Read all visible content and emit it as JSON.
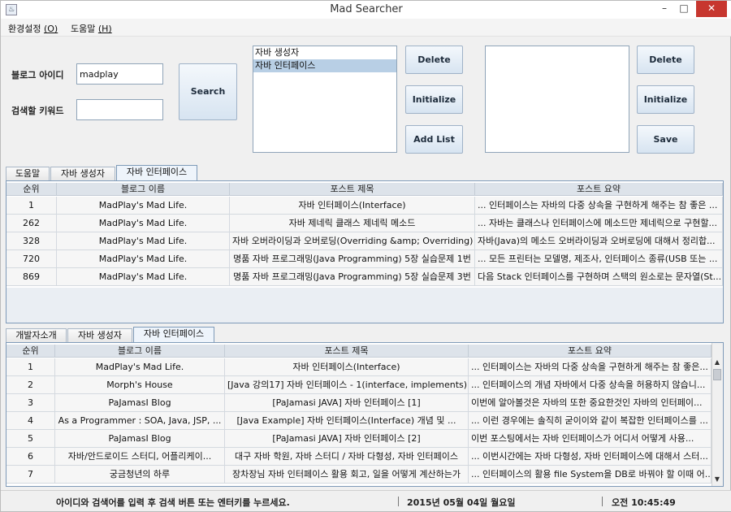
{
  "window": {
    "app_icon": "java-icon",
    "title": "Mad Searcher",
    "minimize": "–",
    "maximize": "□",
    "close": "✕"
  },
  "menu": [
    {
      "label": "환경설정 ",
      "mnemonic": "(O)"
    },
    {
      "label": "도움말 ",
      "mnemonic": "(H)"
    }
  ],
  "form": {
    "blog_id_label": "블로그 아이디",
    "blog_id_value": "madplay",
    "keyword_label": "검색할 키워드",
    "keyword_value": "",
    "search_button": "Search"
  },
  "left_list": {
    "items": [
      "자바 생성자",
      "자바 인터페이스"
    ],
    "selected_index": 1
  },
  "left_buttons": {
    "delete": "Delete",
    "initialize": "Initialize",
    "add_list": "Add List"
  },
  "right_list": {
    "items": []
  },
  "right_buttons": {
    "delete": "Delete",
    "initialize": "Initialize",
    "save": "Save"
  },
  "top_tabs": {
    "items": [
      "도움말",
      "자바 생성자",
      "자바 인터페이스"
    ],
    "active_index": 2
  },
  "top_table": {
    "columns": [
      "순위",
      "블로그 이름",
      "포스트 제목",
      "포스트 요약"
    ],
    "rows": [
      [
        "1",
        "MadPlay's Mad Life.",
        "자바 인터페이스(Interface)",
        "... 인터페이스는 자바의 다중 상속을 구현하게 해주는 참 좋은 ..."
      ],
      [
        "262",
        "MadPlay's Mad Life.",
        "자바 제네릭 클래스 제네릭 메소드",
        "... 자바는 클래스나 인터페이스에 메소드만 제네릭으로 구현할..."
      ],
      [
        "328",
        "MadPlay's Mad Life.",
        "자바 오버라이딩과 오버로딩(Overriding &amp; Overriding)",
        "자바(Java)의 메소드 오버라이딩과 오버로딩에 대해서 정리합..."
      ],
      [
        "720",
        "MadPlay's Mad Life.",
        "명품 자바 프로그래밍(Java Programming) 5장 실습문제 1번",
        "... 모든 프린터는 모델명, 제조사, 인터페이스 종류(USB 또는 ..."
      ],
      [
        "869",
        "MadPlay's Mad Life.",
        "명품 자바 프로그래밍(Java Programming) 5장 실습문제 3번",
        "다음 Stack 인터페이스를 구현하며 스택의 원소로는 문자열(St..."
      ]
    ]
  },
  "bottom_tabs": {
    "items": [
      "개발자소개",
      "자바 생성자",
      "자바 인터페이스"
    ],
    "active_index": 2
  },
  "bottom_table": {
    "columns": [
      "순위",
      "블로그 이름",
      "포스트 제목",
      "포스트 요약"
    ],
    "rows": [
      [
        "1",
        "MadPlay's Mad Life.",
        "자바 인터페이스(Interface)",
        "... 인터페이스는 자바의 다중 상속을 구현하게 해주는 참 좋은..."
      ],
      [
        "2",
        "Morph's House",
        "[Java 강의17] 자바 인터페이스 - 1(interface, implements)",
        "... 인터페이스의 개념 자바에서 다중 상속을 허용하지 않습니..."
      ],
      [
        "3",
        "PaJamasI Blog",
        "[PaJamasi JAVA] 자바 인터페이스 [1]",
        "이번에 알아볼것은 자바의 또한 중요한것인 자바의 인터페이..."
      ],
      [
        "4",
        "As a Programmer : SOA, Java, JSP, ...",
        "[Java Example] 자바 인터페이스(Interface) 개념 및 ...",
        "... 이런 경우에는 솔직히 굳이이와 같이 복잡한 인터페이스를 ..."
      ],
      [
        "5",
        "PaJamasI Blog",
        "[PaJamasi JAVA] 자바 인터페이스 [2]",
        "이번 포스팅에서는 자바 인터페이스가 어디서 어떻게 사용..."
      ],
      [
        "6",
        "자바/안드로이드 스터디, 어플리케이...",
        "대구 자바 학원, 자바 스터디 / 자바 다형성, 자바 인터페이스",
        "... 이번시간에는 자바 다형성, 자바 인터페이스에 대해서 스터..."
      ],
      [
        "7",
        "궁금청년의 하루",
        "장차장님 자바 인터페이스 활용 회고, 일을 어떻게 계산하는가",
        "... 인터페이스의 활용 file System을 DB로 바꿔야 할 이때 어..."
      ]
    ],
    "scroll_fraction": 0.1
  },
  "status_bar": {
    "message": "아이디와 검색어를 입력 후 검색 버튼 또는 엔터키를 누르세요.",
    "date": "2015년 05월 04일 월요일",
    "time": "오전 10:45:49"
  },
  "colors": {
    "selection": "#b8cfe5",
    "tab_border": "#7e9ab8",
    "close_button": "#c7372f"
  }
}
